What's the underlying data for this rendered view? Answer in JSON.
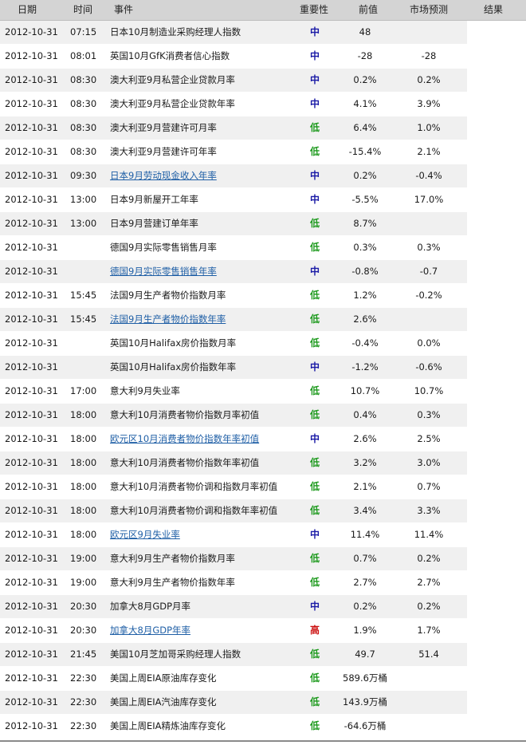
{
  "colors": {
    "low": "#1e9a1e",
    "medium": "#1a1aa6",
    "high": "#cc1111",
    "link": "#1f5fa6",
    "header_bg": "#d4d4d4",
    "row_alt_bg": "#f0f0f0"
  },
  "header": {
    "date": "日期",
    "time": "时间",
    "event": "事件",
    "importance": "重要性",
    "previous": "前值",
    "forecast": "市场预测",
    "result": "结果"
  },
  "rows": [
    {
      "date": "2012-10-31",
      "time": "07:15",
      "event": "日本10月制造业采购经理人指数",
      "link": false,
      "importance": "中",
      "level": "medium",
      "previous": "48",
      "forecast": "",
      "result": ""
    },
    {
      "date": "2012-10-31",
      "time": "08:01",
      "event": "英国10月GfK消费者信心指数",
      "link": false,
      "importance": "中",
      "level": "medium",
      "previous": "-28",
      "forecast": "-28",
      "result": ""
    },
    {
      "date": "2012-10-31",
      "time": "08:30",
      "event": "澳大利亚9月私营企业贷款月率",
      "link": false,
      "importance": "中",
      "level": "medium",
      "previous": "0.2%",
      "forecast": "0.2%",
      "result": ""
    },
    {
      "date": "2012-10-31",
      "time": "08:30",
      "event": "澳大利亚9月私营企业贷款年率",
      "link": false,
      "importance": "中",
      "level": "medium",
      "previous": "4.1%",
      "forecast": "3.9%",
      "result": ""
    },
    {
      "date": "2012-10-31",
      "time": "08:30",
      "event": "澳大利亚9月营建许可月率",
      "link": false,
      "importance": "低",
      "level": "low",
      "previous": "6.4%",
      "forecast": "1.0%",
      "result": ""
    },
    {
      "date": "2012-10-31",
      "time": "08:30",
      "event": "澳大利亚9月营建许可年率",
      "link": false,
      "importance": "低",
      "level": "low",
      "previous": "-15.4%",
      "forecast": "2.1%",
      "result": ""
    },
    {
      "date": "2012-10-31",
      "time": "09:30",
      "event": "日本9月劳动现金收入年率",
      "link": true,
      "importance": "中",
      "level": "medium",
      "previous": "0.2%",
      "forecast": "-0.4%",
      "result": ""
    },
    {
      "date": "2012-10-31",
      "time": "13:00",
      "event": "日本9月新屋开工年率",
      "link": false,
      "importance": "中",
      "level": "medium",
      "previous": "-5.5%",
      "forecast": "17.0%",
      "result": ""
    },
    {
      "date": "2012-10-31",
      "time": "13:00",
      "event": "日本9月营建订单年率",
      "link": false,
      "importance": "低",
      "level": "low",
      "previous": "8.7%",
      "forecast": "",
      "result": ""
    },
    {
      "date": "2012-10-31",
      "time": "",
      "event": "德国9月实际零售销售月率",
      "link": false,
      "importance": "低",
      "level": "low",
      "previous": "0.3%",
      "forecast": "0.3%",
      "result": ""
    },
    {
      "date": "2012-10-31",
      "time": "",
      "event": "德国9月实际零售销售年率",
      "link": true,
      "importance": "中",
      "level": "medium",
      "previous": "-0.8%",
      "forecast": "-0.7",
      "result": ""
    },
    {
      "date": "2012-10-31",
      "time": "15:45",
      "event": "法国9月生产者物价指数月率",
      "link": false,
      "importance": "低",
      "level": "low",
      "previous": "1.2%",
      "forecast": "-0.2%",
      "result": ""
    },
    {
      "date": "2012-10-31",
      "time": "15:45",
      "event": "法国9月生产者物价指数年率",
      "link": true,
      "importance": "低",
      "level": "low",
      "previous": "2.6%",
      "forecast": "",
      "result": ""
    },
    {
      "date": "2012-10-31",
      "time": "",
      "event": "英国10月Halifax房价指数月率",
      "link": false,
      "importance": "低",
      "level": "low",
      "previous": "-0.4%",
      "forecast": "0.0%",
      "result": ""
    },
    {
      "date": "2012-10-31",
      "time": "",
      "event": "英国10月Halifax房价指数年率",
      "link": false,
      "importance": "中",
      "level": "medium",
      "previous": "-1.2%",
      "forecast": "-0.6%",
      "result": ""
    },
    {
      "date": "2012-10-31",
      "time": "17:00",
      "event": "意大利9月失业率",
      "link": false,
      "importance": "低",
      "level": "low",
      "previous": "10.7%",
      "forecast": "10.7%",
      "result": ""
    },
    {
      "date": "2012-10-31",
      "time": "18:00",
      "event": "意大利10月消费者物价指数月率初值",
      "link": false,
      "importance": "低",
      "level": "low",
      "previous": "0.4%",
      "forecast": "0.3%",
      "result": ""
    },
    {
      "date": "2012-10-31",
      "time": "18:00",
      "event": "欧元区10月消费者物价指数年率初值",
      "link": true,
      "importance": "中",
      "level": "medium",
      "previous": "2.6%",
      "forecast": "2.5%",
      "result": ""
    },
    {
      "date": "2012-10-31",
      "time": "18:00",
      "event": "意大利10月消费者物价指数年率初值",
      "link": false,
      "importance": "低",
      "level": "low",
      "previous": "3.2%",
      "forecast": "3.0%",
      "result": ""
    },
    {
      "date": "2012-10-31",
      "time": "18:00",
      "event": "意大利10月消费者物价调和指数月率初值",
      "link": false,
      "importance": "低",
      "level": "low",
      "previous": "2.1%",
      "forecast": "0.7%",
      "result": ""
    },
    {
      "date": "2012-10-31",
      "time": "18:00",
      "event": "意大利10月消费者物价调和指数年率初值",
      "link": false,
      "importance": "低",
      "level": "low",
      "previous": "3.4%",
      "forecast": "3.3%",
      "result": ""
    },
    {
      "date": "2012-10-31",
      "time": "18:00",
      "event": "欧元区9月失业率",
      "link": true,
      "importance": "中",
      "level": "medium",
      "previous": "11.4%",
      "forecast": "11.4%",
      "result": ""
    },
    {
      "date": "2012-10-31",
      "time": "19:00",
      "event": "意大利9月生产者物价指数月率",
      "link": false,
      "importance": "低",
      "level": "low",
      "previous": "0.7%",
      "forecast": "0.2%",
      "result": ""
    },
    {
      "date": "2012-10-31",
      "time": "19:00",
      "event": "意大利9月生产者物价指数年率",
      "link": false,
      "importance": "低",
      "level": "low",
      "previous": "2.7%",
      "forecast": "2.7%",
      "result": ""
    },
    {
      "date": "2012-10-31",
      "time": "20:30",
      "event": "加拿大8月GDP月率",
      "link": false,
      "importance": "中",
      "level": "medium",
      "previous": "0.2%",
      "forecast": "0.2%",
      "result": ""
    },
    {
      "date": "2012-10-31",
      "time": "20:30",
      "event": "加拿大8月GDP年率",
      "link": true,
      "importance": "高",
      "level": "high",
      "previous": "1.9%",
      "forecast": "1.7%",
      "result": ""
    },
    {
      "date": "2012-10-31",
      "time": "21:45",
      "event": "美国10月芝加哥采购经理人指数",
      "link": false,
      "importance": "低",
      "level": "low",
      "previous": "49.7",
      "forecast": "51.4",
      "result": ""
    },
    {
      "date": "2012-10-31",
      "time": "22:30",
      "event": "美国上周EIA原油库存变化",
      "link": false,
      "importance": "低",
      "level": "low",
      "previous": "589.6万桶",
      "forecast": "",
      "result": ""
    },
    {
      "date": "2012-10-31",
      "time": "22:30",
      "event": "美国上周EIA汽油库存变化",
      "link": false,
      "importance": "低",
      "level": "low",
      "previous": "143.9万桶",
      "forecast": "",
      "result": ""
    },
    {
      "date": "2012-10-31",
      "time": "22:30",
      "event": "美国上周EIA精炼油库存变化",
      "link": false,
      "importance": "低",
      "level": "low",
      "previous": "-64.6万桶",
      "forecast": "",
      "result": ""
    }
  ]
}
